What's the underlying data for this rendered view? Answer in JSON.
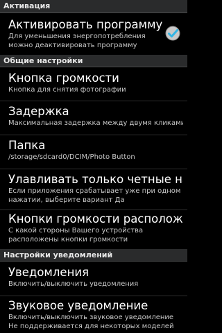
{
  "sections": [
    {
      "header": "Активация"
    },
    {
      "header": "Общие настройки"
    },
    {
      "header": "Настройки уведомлений"
    }
  ],
  "prefs": {
    "activate": {
      "title": "Активировать программу",
      "summary_line1": "Для уменьшения энергопотребления",
      "summary_line2": "можно деактивировать программу",
      "checked": true
    },
    "volume_button": {
      "title": "Кнопка громкости",
      "summary": "Кнопка для снятия фотографии"
    },
    "delay": {
      "title": "Задержка",
      "summary": "Максимальная задержка между двумя кликами"
    },
    "folder": {
      "title": "Папка",
      "summary": "/storage/sdcard0/DCIM/Photo Button"
    },
    "even_presses": {
      "title": "Улавливать только четные наж",
      "summary_line1": "Если приложения срабатывает уже при одном",
      "summary_line2": "нажатии, выберите вариант Да"
    },
    "button_location": {
      "title": "Кнопки громкости расположен",
      "summary_line1": "С какой стороны Вашего устройства",
      "summary_line2": "расположены кнопки громкости"
    },
    "notifications": {
      "title": "Уведомления",
      "summary": "Включить/выключить уведомления"
    },
    "sound_notification": {
      "title": "Звуковое уведомление",
      "summary_line1": "Включить/выключить звуковое уведомление",
      "summary_line2": "Не поддерживается для некоторых моделей"
    }
  },
  "colors": {
    "checkbox_fill": "#c9c9c9",
    "checkmark": "#33b5e5"
  }
}
